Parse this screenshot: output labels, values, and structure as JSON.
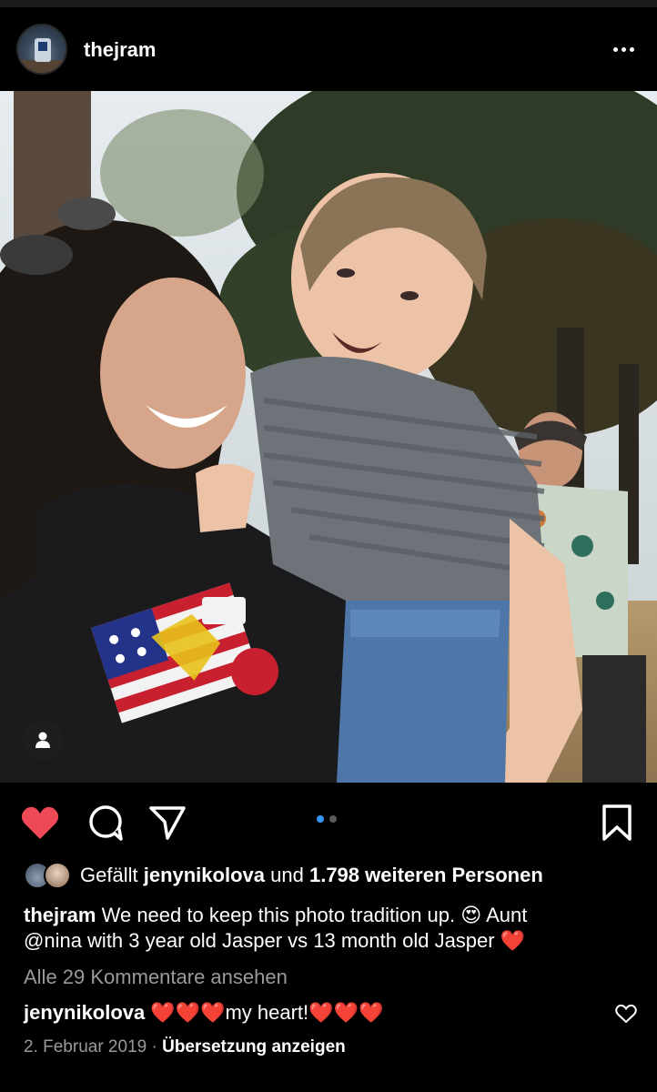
{
  "post": {
    "username": "thejram",
    "more_icon": "more-horizontal-icon"
  },
  "photo": {
    "alt": "",
    "carousel": {
      "count": 2,
      "active_index": 0
    }
  },
  "actions": {
    "like_icon": "heart-filled-icon",
    "comment_icon": "comment-bubble-icon",
    "share_icon": "paper-plane-icon",
    "save_icon": "bookmark-icon",
    "like_color": "#ed4956",
    "accent_color": "#3897f0"
  },
  "likes": {
    "prefix": "Gefällt",
    "user": "jenynikolova",
    "connector": "und",
    "count_text": "1.798 weiteren Personen"
  },
  "caption": {
    "username": "thejram",
    "line1": "We need to keep this photo tradition up. 😍 Aunt",
    "line2": "@nina with 3 year old Jasper vs 13 month old Jasper ❤️"
  },
  "comments": {
    "view_all": "Alle 29 Kommentare ansehen",
    "items": [
      {
        "username": "jenynikolova",
        "text": "❤️❤️❤️my heart!❤️❤️❤️"
      }
    ]
  },
  "meta": {
    "date": "2. Februar 2019",
    "separator": "·",
    "translate": "Übersetzung anzeigen"
  }
}
